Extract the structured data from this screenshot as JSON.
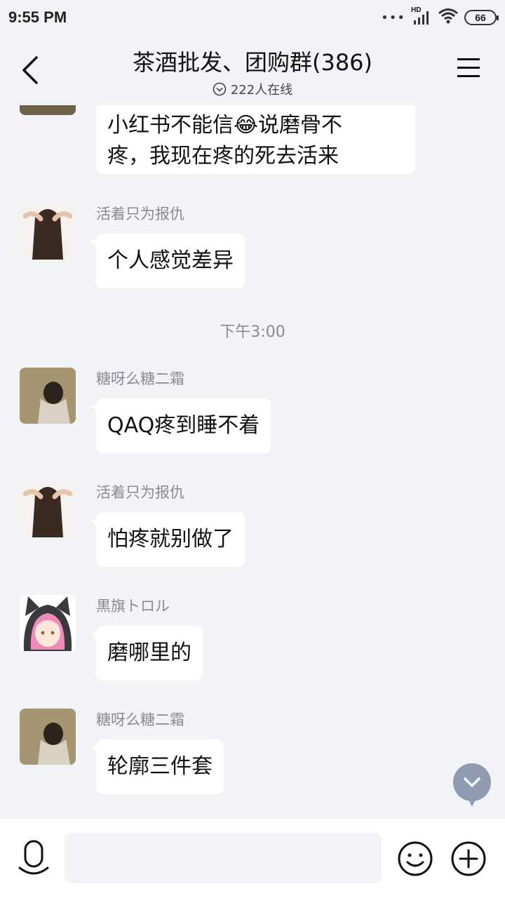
{
  "status_bar": {
    "time": "9:55 PM",
    "network": "HD",
    "battery": "66"
  },
  "header": {
    "title": "茶酒批发、团购群(386)",
    "online": "222人在线"
  },
  "messages": [
    {
      "nick": "",
      "lines": [
        "小红书不能信😂说磨骨不",
        "疼，我现在疼的死去活来"
      ]
    },
    {
      "nick": "活着只为报仇",
      "text": "个人感觉差异"
    },
    {
      "nick": "糖呀么糖二霜",
      "text": "QAQ疼到睡不着"
    },
    {
      "nick": "活着只为报仇",
      "text": "怕疼就别做了"
    },
    {
      "nick": "黒旗トロル",
      "text": "磨哪里的"
    },
    {
      "nick": "糖呀么糖二霜",
      "text": "轮廓三件套"
    }
  ],
  "timestamp": "下午3:00",
  "input": {
    "placeholder": ""
  },
  "colors": {
    "background": "#f2f3f7",
    "bubble": "#ffffff",
    "nickname": "#8a8a94",
    "scroll_button": "#8f9bb0"
  }
}
